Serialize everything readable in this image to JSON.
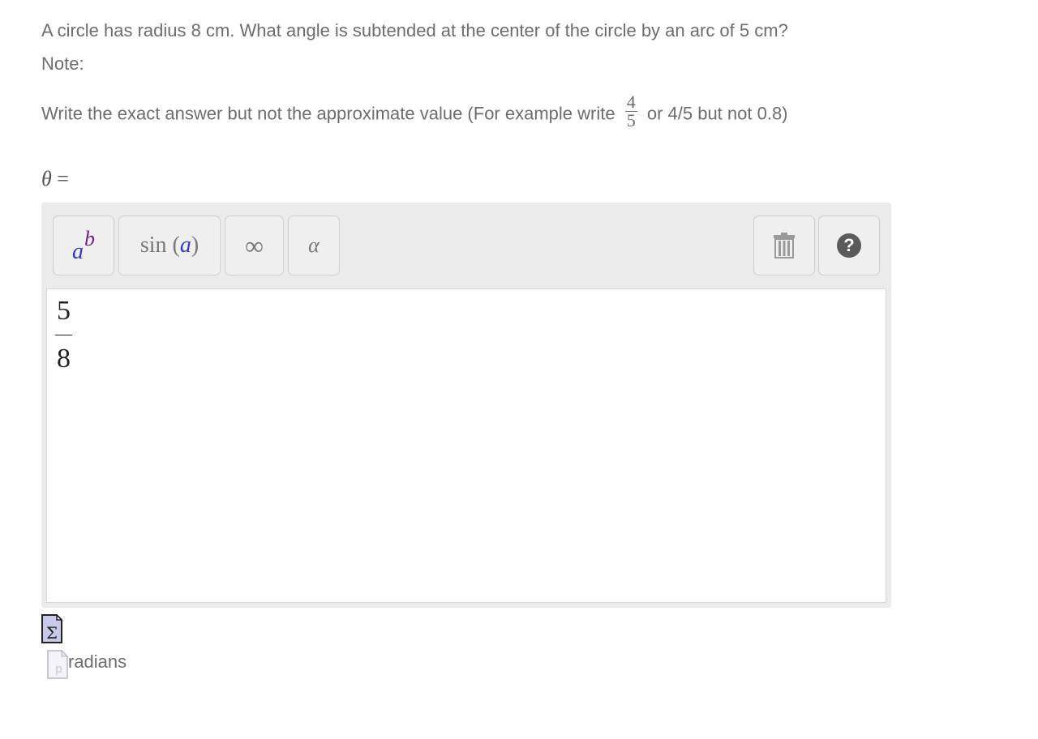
{
  "question": {
    "line1": "A circle has radius 8 cm. What angle is subtended at the center of the circle by an arc of 5 cm?",
    "line2": "Note:",
    "line3_before": "Write the exact answer but not the approximate value (For example write",
    "example_fraction": {
      "numerator": "4",
      "denominator": "5"
    },
    "line3_after": "or 4/5 but not 0.8)"
  },
  "answer_label": {
    "symbol": "θ",
    "equals": "="
  },
  "toolbar": {
    "power": {
      "base": "a",
      "exponent": "b",
      "icon": "power-icon"
    },
    "trig": {
      "func": "sin",
      "open": "(",
      "arg": "a",
      "close": ")"
    },
    "infinity": "∞",
    "greek": "α",
    "trash_icon": "trash-icon",
    "help": "?"
  },
  "answer": {
    "numerator": "5",
    "denominator": "8"
  },
  "units": "radians",
  "colors": {
    "text": "#6d6d6d",
    "editor_bg": "#ebebeb",
    "accent_blue": "#2a3bd1",
    "accent_purple": "#7a1c8a"
  }
}
